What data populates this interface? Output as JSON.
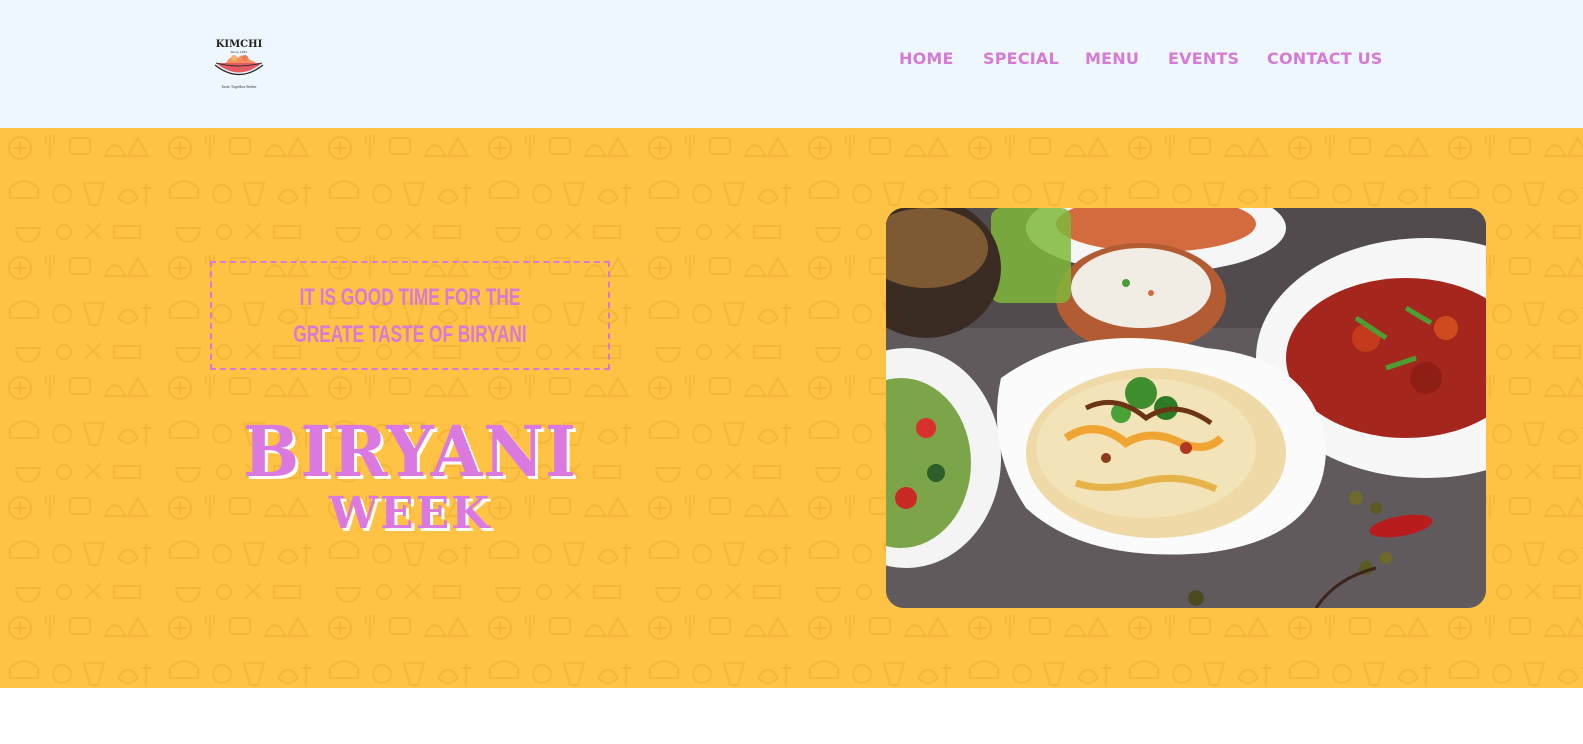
{
  "header": {
    "logo": {
      "name": "KIMCHI",
      "since": "Since 1987",
      "tagline": "Taste Together Better",
      "icon": "food-bowl-logo"
    },
    "nav": [
      {
        "label": "HOME"
      },
      {
        "label": "SPECIAL"
      },
      {
        "label": "MENU"
      },
      {
        "label": "EVENTS"
      },
      {
        "label": "CONTACT US"
      }
    ]
  },
  "hero": {
    "tagline": "IT IS GOOD TIME FOR THE GREATE TASTE OF BIRYANI",
    "title": "BIRYANI",
    "subtitle": "WEEK",
    "image": "biryani-bowl-photo"
  },
  "colors": {
    "accent": "#d77ad6",
    "hero_bg": "#fec344",
    "header_bg": "#eef7fd"
  }
}
